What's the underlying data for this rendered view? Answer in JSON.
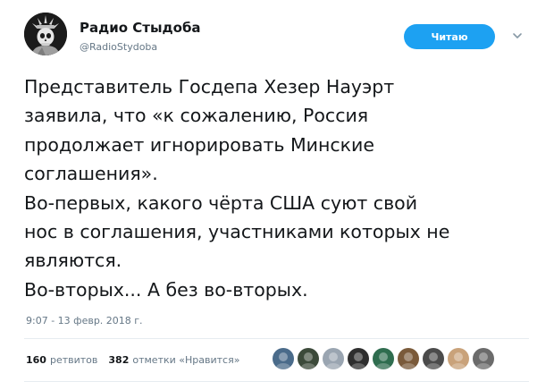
{
  "author": {
    "name": "Радио Стыдоба",
    "handle": "@RadioStydoba"
  },
  "follow_button_label": "Читаю",
  "tweet": {
    "lines": [
      "Представитель Госдепа Хезер Науэрт",
      "заявила, что «к сожалению, Россия",
      "продолжает игнорировать Минские",
      "соглашения».",
      "Во-первых, какого чёрта США суют свой",
      "нос в соглашения, участниками которых не",
      "являются.",
      "Во-вторых... А без во-вторых."
    ],
    "timestamp": "9:07 - 13 февр. 2018 г."
  },
  "stats": {
    "retweets_count": "160",
    "retweets_label": "ретвитов",
    "likes_count": "382",
    "likes_label": "отметки «Нравится»"
  },
  "likers": [
    {
      "color": "#4a6b8a"
    },
    {
      "color": "#3c4a3a"
    },
    {
      "color": "#9aa5b1"
    },
    {
      "color": "#2e2e2e"
    },
    {
      "color": "#2f6d4f"
    },
    {
      "color": "#7a5a3a"
    },
    {
      "color": "#4b4b4b"
    },
    {
      "color": "#c9a27a"
    },
    {
      "color": "#6b6b6b"
    }
  ],
  "icons": {
    "avatar": "statue-of-liberty-skull-avatar",
    "caret": "chevron-down-icon"
  }
}
